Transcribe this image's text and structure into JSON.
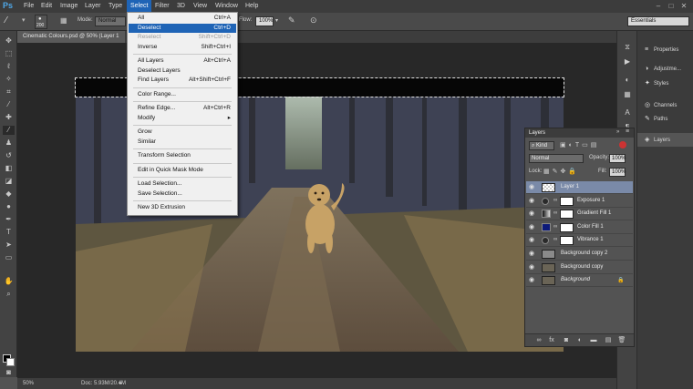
{
  "app": {
    "logo": "Ps"
  },
  "menubar": {
    "items": [
      "File",
      "Edit",
      "Image",
      "Layer",
      "Type",
      "Select",
      "Filter",
      "3D",
      "View",
      "Window",
      "Help"
    ],
    "active": "Select"
  },
  "options_bar": {
    "brush_size": "200",
    "mode_label": "Mode:",
    "mode_value": "Normal",
    "flow_label": "Flow:",
    "flow_value": "100%",
    "workspace": "Essentials"
  },
  "document": {
    "tab_title": "Cinematic Colours.psd @ 50% (Layer 1",
    "zoom": "50%",
    "doc_size": "Doc: 5.93M/20.4M"
  },
  "select_menu": {
    "groups": [
      [
        {
          "label": "All",
          "shortcut": "Ctrl+A"
        },
        {
          "label": "Deselect",
          "shortcut": "Ctrl+D",
          "highlighted": true
        },
        {
          "label": "Reselect",
          "shortcut": "Shift+Ctrl+D",
          "disabled": true
        },
        {
          "label": "Inverse",
          "shortcut": "Shift+Ctrl+I"
        }
      ],
      [
        {
          "label": "All Layers",
          "shortcut": "Alt+Ctrl+A"
        },
        {
          "label": "Deselect Layers",
          "shortcut": ""
        },
        {
          "label": "Find Layers",
          "shortcut": "Alt+Shift+Ctrl+F"
        }
      ],
      [
        {
          "label": "Color Range...",
          "shortcut": ""
        }
      ],
      [
        {
          "label": "Refine Edge...",
          "shortcut": "Alt+Ctrl+R"
        },
        {
          "label": "Modify",
          "shortcut": "▸"
        }
      ],
      [
        {
          "label": "Grow",
          "shortcut": ""
        },
        {
          "label": "Similar",
          "shortcut": ""
        }
      ],
      [
        {
          "label": "Transform Selection",
          "shortcut": ""
        }
      ],
      [
        {
          "label": "Edit in Quick Mask Mode",
          "shortcut": ""
        }
      ],
      [
        {
          "label": "Load Selection...",
          "shortcut": ""
        },
        {
          "label": "Save Selection...",
          "shortcut": ""
        }
      ],
      [
        {
          "label": "New 3D Extrusion",
          "shortcut": ""
        }
      ]
    ]
  },
  "right_dock": {
    "items": [
      {
        "label": "Properties",
        "icon": "sliders-icon"
      },
      {
        "label": "Adjustme...",
        "icon": "adjustments-icon"
      },
      {
        "label": "Styles",
        "icon": "styles-icon"
      },
      {
        "label": "Channels",
        "icon": "channels-icon"
      },
      {
        "label": "Paths",
        "icon": "paths-icon"
      },
      {
        "label": "Layers",
        "icon": "layers-icon"
      }
    ]
  },
  "layers_panel": {
    "title": "Layers",
    "filter_kind": "Kind",
    "blend_mode": "Normal",
    "opacity_label": "Opacity:",
    "opacity_value": "100%",
    "lock_label": "Lock:",
    "fill_label": "Fill:",
    "fill_value": "100%",
    "layers": [
      {
        "name": "Layer 1",
        "selected": true,
        "type": "pixel",
        "thumb_color": "#dfe6f0"
      },
      {
        "name": "Exposure 1",
        "type": "adjustment",
        "thumb_color": "#ffffff"
      },
      {
        "name": "Gradient Fill 1",
        "type": "adjustment",
        "thumb_color": "#777777"
      },
      {
        "name": "Color Fill 1",
        "type": "fill",
        "thumb_color": "#0d1a7a"
      },
      {
        "name": "Vibrance 1",
        "type": "adjustment",
        "thumb_color": "#ffffff"
      },
      {
        "name": "Background copy 2",
        "type": "pixel",
        "thumb_color": "#8a8a8a"
      },
      {
        "name": "Background copy",
        "type": "pixel",
        "thumb_color": "#6a6456"
      },
      {
        "name": "Background",
        "type": "locked",
        "thumb_color": "#6a6456"
      }
    ]
  }
}
